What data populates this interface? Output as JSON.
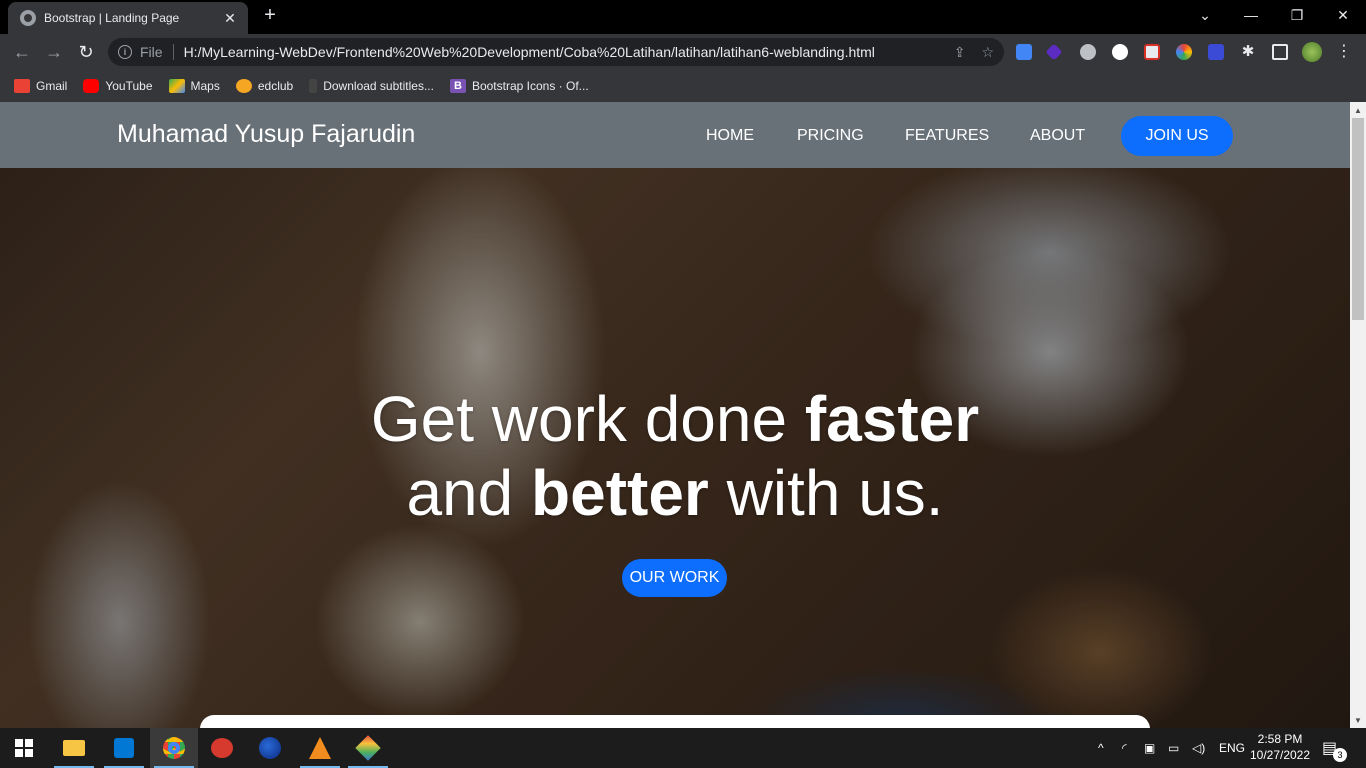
{
  "browser": {
    "tab_title": "Bootstrap | Landing Page",
    "url_prefix": "File",
    "url": "H:/MyLearning-WebDev/Frontend%20Web%20Development/Coba%20Latihan/latihan/latihan6-weblanding.html"
  },
  "bookmarks": [
    {
      "label": "Gmail",
      "icon": "gmail-icon",
      "color": "#ea4335"
    },
    {
      "label": "YouTube",
      "icon": "youtube-icon",
      "color": "#ff0000"
    },
    {
      "label": "Maps",
      "icon": "maps-icon",
      "color": "#34a853"
    },
    {
      "label": "edclub",
      "icon": "edclub-icon",
      "color": "#f5a623"
    },
    {
      "label": "Download subtitles...",
      "icon": "subtitles-icon",
      "color": "#444444"
    },
    {
      "label": "Bootstrap Icons · Of...",
      "icon": "bootstrap-icon",
      "color": "#7952b3"
    }
  ],
  "site": {
    "brand": "Muhamad Yusup Fajarudin",
    "nav": [
      "HOME",
      "PRICING",
      "FEATURES",
      "ABOUT"
    ],
    "join_label": "JOIN US",
    "headline": {
      "line1_light": "Get work done",
      "line1_bold": "faster",
      "line2_light_a": "and",
      "line2_bold": "better",
      "line2_light_b": "with us."
    },
    "cta_label": "OUR WORK"
  },
  "taskbar": {
    "lang": "ENG",
    "time": "2:58 PM",
    "date": "10/27/2022",
    "notifications": "3"
  },
  "colors": {
    "accent": "#0d6efd",
    "navbar": "#6c757d"
  }
}
